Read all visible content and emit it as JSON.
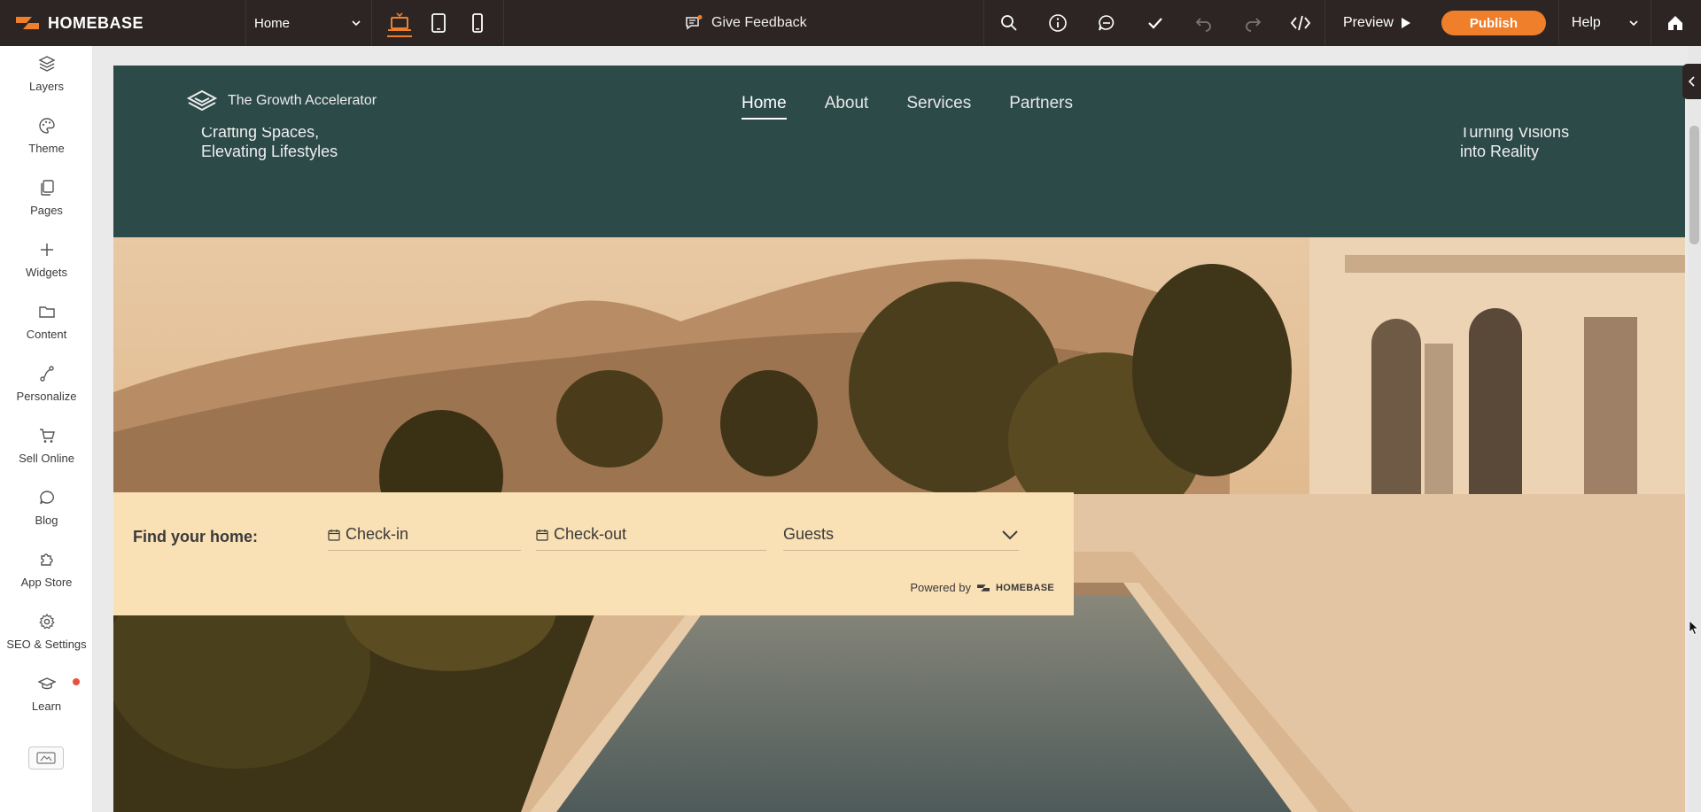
{
  "topbar": {
    "brand": "HOMEBASE",
    "page_select": "Home",
    "feedback": "Give Feedback",
    "preview": "Preview",
    "publish": "Publish",
    "help": "Help"
  },
  "sidebar": {
    "items": [
      {
        "label": "Layers",
        "icon": "layers-icon"
      },
      {
        "label": "Theme",
        "icon": "palette-icon"
      },
      {
        "label": "Pages",
        "icon": "pages-icon"
      },
      {
        "label": "Widgets",
        "icon": "plus-icon"
      },
      {
        "label": "Content",
        "icon": "folder-icon"
      },
      {
        "label": "Personalize",
        "icon": "personalize-icon"
      },
      {
        "label": "Sell Online",
        "icon": "cart-icon"
      },
      {
        "label": "Blog",
        "icon": "chat-bubble-icon"
      },
      {
        "label": "App Store",
        "icon": "puzzle-icon"
      },
      {
        "label": "SEO & Settings",
        "icon": "gear-icon"
      },
      {
        "label": "Learn",
        "icon": "graduation-cap-icon"
      }
    ]
  },
  "site": {
    "brand": "The Growth Accelerator",
    "nav": [
      "Home",
      "About",
      "Services",
      "Partners"
    ],
    "tagline_left": [
      "Crafting Spaces,",
      "Elevating Lifestyles"
    ],
    "tagline_right": [
      "Turning Visions",
      "into Reality"
    ],
    "colors": {
      "header": "#2c4a48",
      "booking": "#f9e0b5",
      "accent": "#ef7f2a"
    }
  },
  "booking": {
    "title": "Find your home:",
    "checkin": "Check-in",
    "checkout": "Check-out",
    "guests": "Guests",
    "powered_by": "Powered by",
    "powered_brand": "HOMEBASE"
  }
}
